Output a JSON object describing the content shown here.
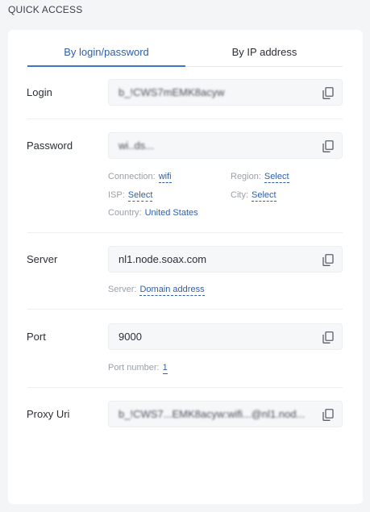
{
  "section_title": "QUICK ACCESS",
  "tabs": [
    {
      "label": "By login/password",
      "active": true
    },
    {
      "label": "By IP address",
      "active": false
    }
  ],
  "login": {
    "label": "Login",
    "value": "b_!CWS7mEMK8acyw"
  },
  "password": {
    "label": "Password",
    "value": "wi..ds..."
  },
  "filters": {
    "connection_label": "Connection:",
    "connection_value": "wifi",
    "region_label": "Region:",
    "region_value": "Select",
    "isp_label": "ISP:",
    "isp_value": "Select",
    "city_label": "City:",
    "city_value": "Select",
    "country_label": "Country:",
    "country_value": "United States"
  },
  "server": {
    "label": "Server",
    "value": "nl1.node.soax.com",
    "meta_label": "Server:",
    "meta_value": "Domain address"
  },
  "port": {
    "label": "Port",
    "value": "9000",
    "meta_label": "Port number:",
    "meta_value": "1"
  },
  "proxy_uri": {
    "label": "Proxy Uri",
    "value": "b_!CWS7...EMK8acyw:wifi...@nl1.nod..."
  },
  "icons": {
    "copy": "copy-icon"
  },
  "colors": {
    "accent": "#3a76c9",
    "link": "#2f5fa7",
    "background": "#f4f5f7"
  }
}
